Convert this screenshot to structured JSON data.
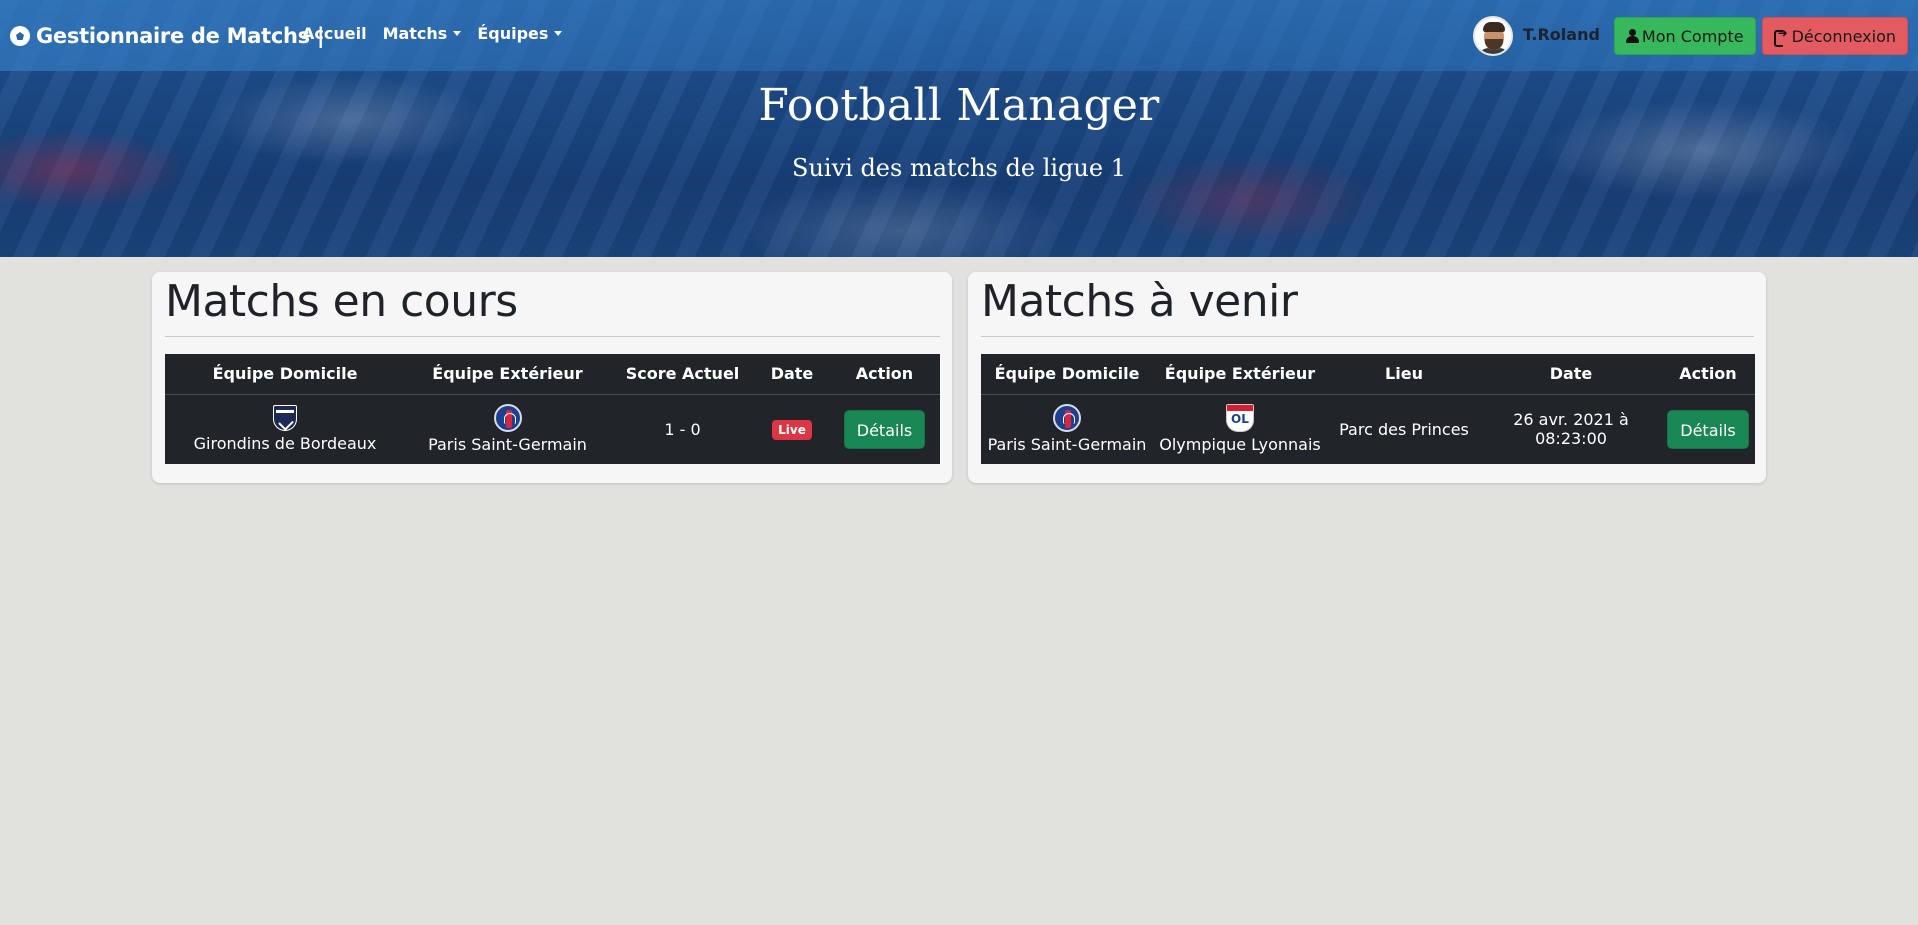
{
  "navbar": {
    "brand": "Gestionnaire de Matchs |",
    "links": [
      {
        "label": "Accueil"
      },
      {
        "label": "Matchs"
      },
      {
        "label": "Équipes"
      }
    ],
    "user": {
      "name": "T.Roland"
    },
    "account_button": "Mon Compte",
    "logout_button": "Déconnexion"
  },
  "hero": {
    "title": "Football Manager",
    "subtitle": "Suivi des matchs de ligue 1"
  },
  "current_matches": {
    "title": "Matchs en cours",
    "columns": [
      "Équipe Domicile",
      "Équipe Extérieur",
      "Score Actuel",
      "Date",
      "Action"
    ],
    "rows": [
      {
        "home": "Girondins de Bordeaux",
        "away": "Paris Saint-Germain",
        "score": "1 - 0",
        "date_badge": "Live",
        "action": "Détails"
      }
    ]
  },
  "upcoming_matches": {
    "title": "Matchs à venir",
    "columns": [
      "Équipe Domicile",
      "Équipe Extérieur",
      "Lieu",
      "Date",
      "Action"
    ],
    "rows": [
      {
        "home": "Paris Saint-Germain",
        "away": "Olympique Lyonnais",
        "venue": "Parc des Princes",
        "date": "26 avr. 2021 à 08:23:00",
        "action": "Détails"
      }
    ]
  },
  "colors": {
    "page_bg": "#e1e2dd",
    "table_bg": "#212529",
    "success": "#198754",
    "danger": "#dc3545",
    "account_btn": "#38b85c",
    "logout_btn": "#e35b61"
  }
}
